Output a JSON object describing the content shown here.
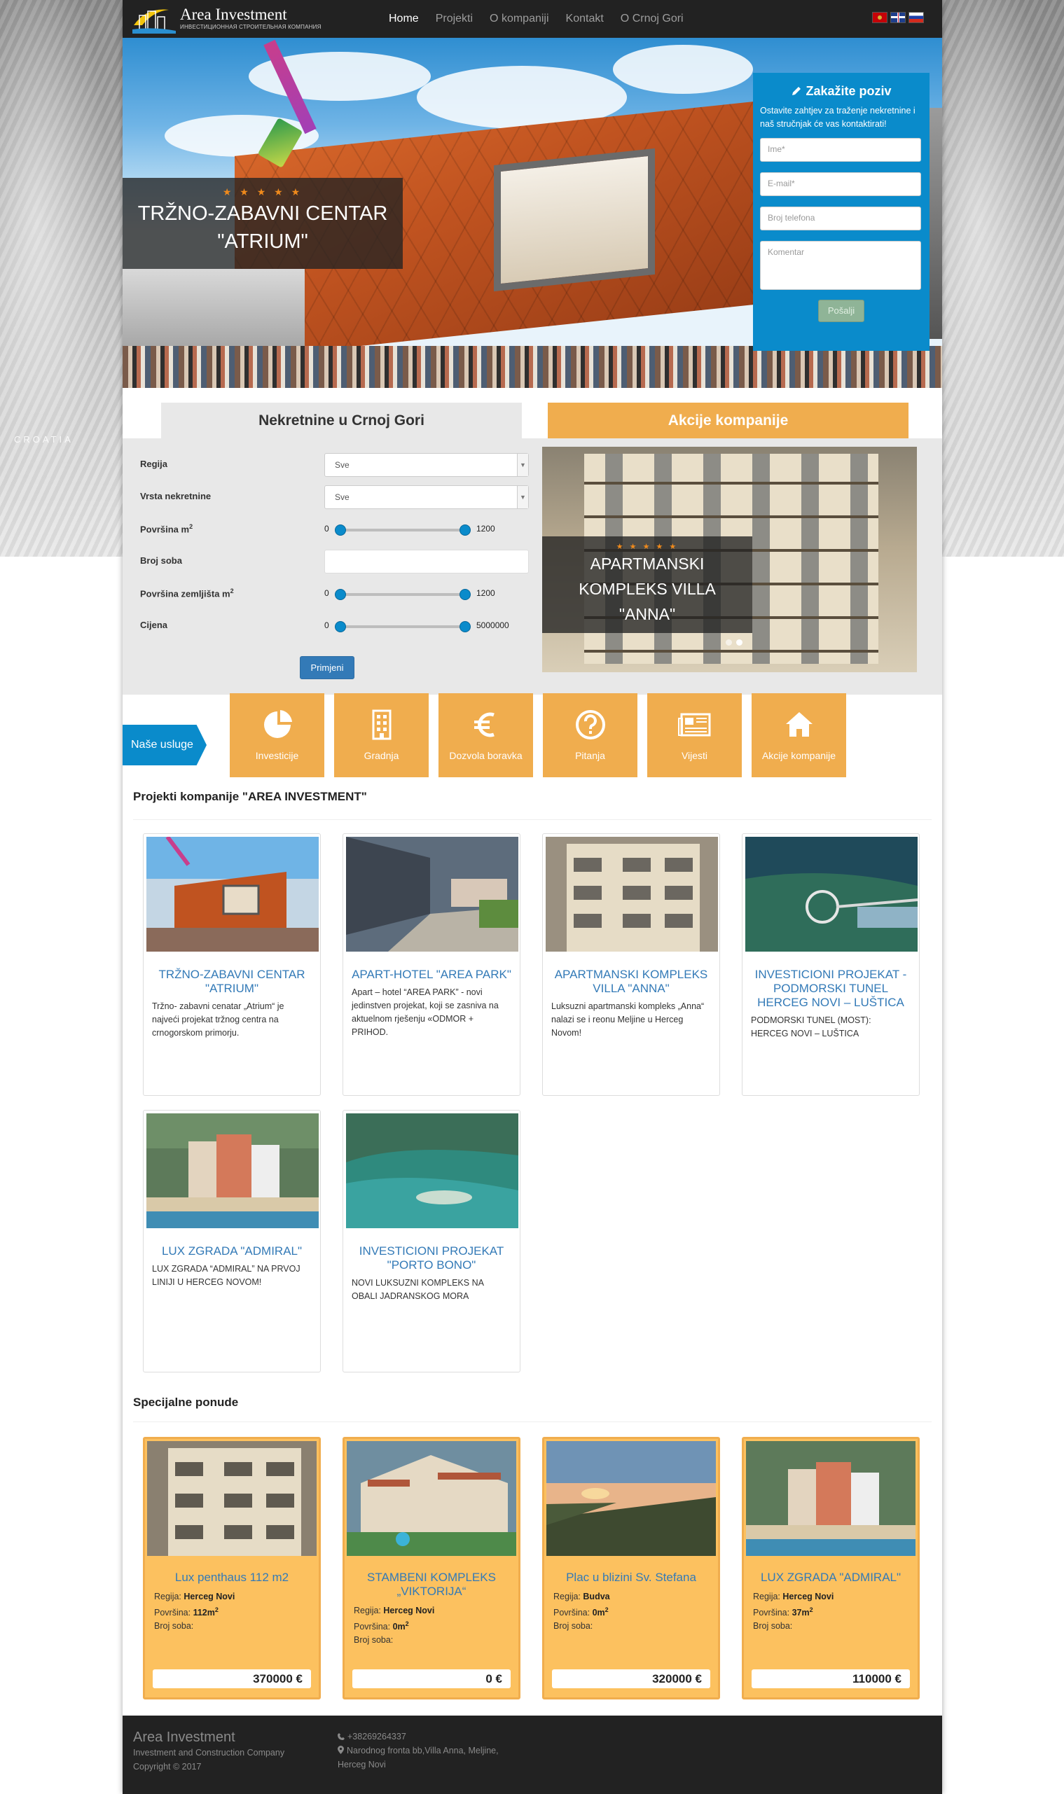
{
  "brand": {
    "name": "Area Investment",
    "subtitle": "ИНВЕСТИЦИОННАЯ СТРОИТЕЛЬНАЯ КОМПАНИЯ",
    "background_label": "CROATIA"
  },
  "nav": {
    "items": [
      "Home",
      "Projekti",
      "O kompaniji",
      "Kontakt",
      "O Crnoj Gori"
    ],
    "active": "Home",
    "languages": [
      "me",
      "en",
      "ru"
    ]
  },
  "hero": {
    "stars": "★ ★ ★ ★ ★",
    "title_line1": "TRŽNO-ZABAVNI CENTAR",
    "title_line2": "\"ATRIUM\""
  },
  "call_form": {
    "title": "Zakažite poziv",
    "text": "Ostavite zahtjev za traženje nekretnine i naš stručnjak će vas kontaktirati!",
    "name_placeholder": "Ime*",
    "email_placeholder": "E-mail*",
    "phone_placeholder": "Broj telefona",
    "comment_placeholder": "Komentar",
    "submit_label": "Pošalji"
  },
  "tabs": {
    "real_estate": "Nekretnine u Crnoj Gori",
    "promotions": "Akcije kompanije"
  },
  "search": {
    "region_label": "Regija",
    "region_value": "Sve",
    "type_label": "Vrsta nekretnine",
    "type_value": "Sve",
    "area_label": "Površina m",
    "area_min": "0",
    "area_max": "1200",
    "rooms_label": "Broj soba",
    "land_label": "Površina zemljišta m",
    "land_min": "0",
    "land_max": "1200",
    "price_label": "Cijena",
    "price_min": "0",
    "price_max": "5000000",
    "apply_label": "Primjeni"
  },
  "promo": {
    "stars": "★ ★ ★ ★ ★",
    "title_line1": "APARTMANSKI",
    "title_line2": "KOMPLEKS VILLA",
    "title_line3": "\"ANNA\""
  },
  "services": {
    "label": "Naše usluge",
    "items": [
      {
        "label": "Investicije",
        "icon": "pie-chart-icon"
      },
      {
        "label": "Gradnja",
        "icon": "building-icon"
      },
      {
        "label": "Dozvola boravka",
        "icon": "euro-icon"
      },
      {
        "label": "Pitanja",
        "icon": "question-icon"
      },
      {
        "label": "Vijesti",
        "icon": "newspaper-icon"
      },
      {
        "label": "Akcije kompanije",
        "icon": "home-icon"
      }
    ]
  },
  "projects": {
    "title": "Projekti kompanije \"AREA INVESTMENT\"",
    "items": [
      {
        "title": "TRŽNO-ZABAVNI CENTAR \"ATRIUM\"",
        "desc": "Tržno- zabavni cenatar „Atrium“ je najveći projekat tržnog centra na crnogorskom primorju."
      },
      {
        "title": "APART-HOTEL \"AREA PARK\"",
        "desc": "Apart – hotel “AREA PARK” - novi jedinstven projekat, koji se zasniva na aktuelnom rješenju «ODMOR + PRIHOD."
      },
      {
        "title": "APARTMANSKI KOMPLEKS VILLA \"ANNA\"",
        "desc": "Luksuzni apartmanski kompleks „Anna“ nalazi se i reonu Meljine u Herceg Novom!"
      },
      {
        "title": "INVESTICIONI PROJEKAT -PODMORSKI TUNEL HERCEG NOVI – LUŠTICA",
        "desc": "PODMORSKI TUNEL (MOST): HERCEG NOVI – LUŠTICA"
      },
      {
        "title": "LUX ZGRADA \"ADMIRAL\"",
        "desc": "LUX ZGRADA “ADMIRAL” NA PRVOJ LINIJI U HERCEG NOVOM!"
      },
      {
        "title": "INVESTICIONI PROJEKAT \"PORTO BONO\"",
        "desc": "NOVI LUKSUZNI KOMPLEKS NA OBALI JADRANSKOG MORA"
      }
    ]
  },
  "offers": {
    "title": "Specijalne ponude",
    "region_label": "Regija:",
    "area_label": "Površina:",
    "rooms_label": "Broj soba:",
    "items": [
      {
        "title": "Lux penthaus 112 m2",
        "region": "Herceg Novi",
        "area": "112m",
        "price": "370000 €"
      },
      {
        "title": "STAMBENI KOMPLEKS „VIKTORIJA“",
        "region": "Herceg Novi",
        "area": "0m",
        "price": "0 €"
      },
      {
        "title": "Plac u blizini Sv. Stefana",
        "region": "Budva",
        "area": "0m",
        "price": "320000 €"
      },
      {
        "title": "LUX ZGRADA \"ADMIRAL\"",
        "region": "Herceg Novi",
        "area": "37m",
        "price": "110000 €"
      }
    ]
  },
  "footer": {
    "name": "Area Investment",
    "tagline": "Investment and Construction Company",
    "copyright": "Copyright © 2017",
    "phone": "+38269264337",
    "address": "Narodnog fronta bb,Villa Anna, Meljine, Herceg Novi"
  },
  "colors": {
    "accent_blue": "#0a8bcb",
    "accent_orange": "#f0ad4e",
    "offer_bg": "#fcc15f",
    "link_blue": "#337ab7",
    "nav_bg": "#222222"
  }
}
